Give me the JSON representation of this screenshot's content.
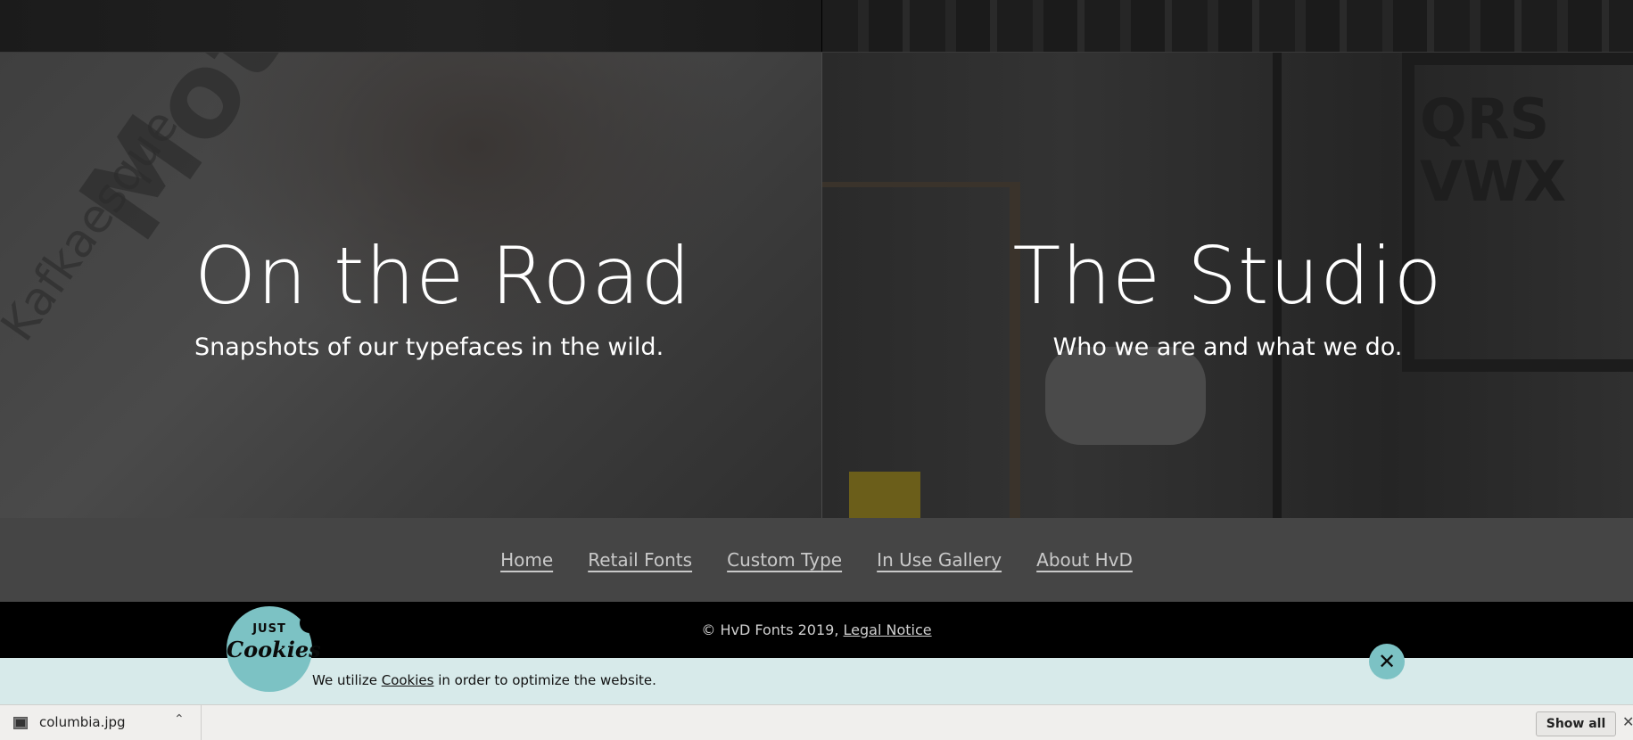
{
  "panels": {
    "left": {
      "title": "On the Road",
      "subtitle": "Snapshots of our typefaces in the wild."
    },
    "right": {
      "title": "The Studio",
      "subtitle": "Who we are and what we do."
    }
  },
  "footer_nav": {
    "items": [
      "Home",
      "Retail Fonts",
      "Custom Type",
      "In Use Gallery",
      "About HvD"
    ]
  },
  "copyright": {
    "text": "© HvD Fonts 2019, ",
    "legal_link": "Legal Notice"
  },
  "cookie_banner": {
    "logo_top": "JUST",
    "logo_bottom": "Cookies",
    "text_before": "We utilize ",
    "link": "Cookies",
    "text_after": " in order to optimize the website.",
    "close_icon": "close-icon"
  },
  "download_bar": {
    "file_name": "columbia.jpg",
    "show_all_label": "Show all",
    "caret_icon": "chevron-up-icon",
    "close_icon": "close-icon"
  },
  "colors": {
    "accent": "#7cc2c4",
    "cookie_banner_bg": "#d7eaea",
    "footer_bg": "#454545"
  }
}
